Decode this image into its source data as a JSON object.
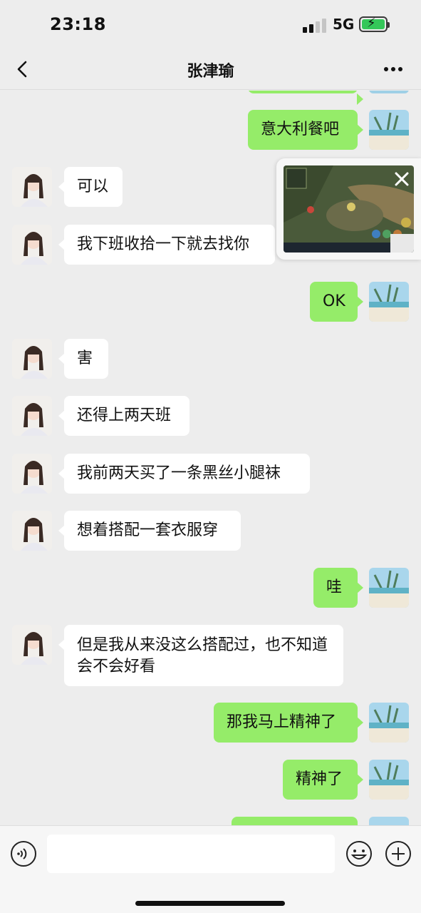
{
  "status_bar": {
    "time": "23:18",
    "network": "5G"
  },
  "header": {
    "title": "张津瑜"
  },
  "messages": [
    {
      "side": "out",
      "text": "意大利餐吧"
    },
    {
      "side": "in",
      "text": "可以"
    },
    {
      "side": "in",
      "text": "我下班收拾一下就去找你"
    },
    {
      "side": "out",
      "text": "OK"
    },
    {
      "side": "in",
      "text": "害"
    },
    {
      "side": "in",
      "text": "还得上两天班"
    },
    {
      "side": "in",
      "text": "我前两天买了一条黑丝小腿袜"
    },
    {
      "side": "in",
      "text": "想着搭配一套衣服穿"
    },
    {
      "side": "out",
      "text": "哇"
    },
    {
      "side": "in",
      "text": "但是我从来没这么搭配过，也不知道会不会好看"
    },
    {
      "side": "out",
      "text": "那我马上精神了"
    },
    {
      "side": "out",
      "text": "精神了"
    }
  ],
  "mini_video": {
    "label": "game-stream-preview"
  },
  "input": {
    "value": "",
    "placeholder": ""
  },
  "colors": {
    "background": "#ededed",
    "incoming_bubble": "#ffffff",
    "outgoing_bubble": "#95ec69",
    "battery": "#34c759"
  },
  "icons": [
    "back-icon",
    "more-icon",
    "close-icon",
    "voice-icon",
    "emoji-icon",
    "plus-icon"
  ]
}
